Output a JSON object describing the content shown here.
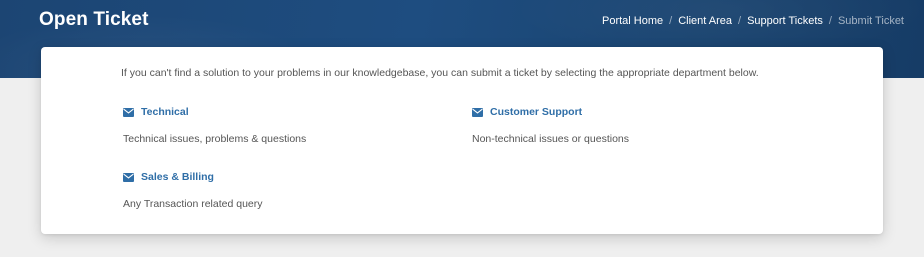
{
  "header": {
    "title": "Open Ticket",
    "breadcrumb": [
      "Portal Home",
      "Client Area",
      "Support Tickets",
      "Submit Ticket"
    ],
    "separator": "/"
  },
  "intro": "If you can't find a solution to your problems in our knowledgebase, you can submit a ticket by selecting the appropriate department below.",
  "departments": [
    {
      "name": "Technical",
      "description": "Technical issues, problems & questions",
      "icon": "envelope-icon"
    },
    {
      "name": "Customer Support",
      "description": "Non-technical issues or questions",
      "icon": "envelope-icon"
    },
    {
      "name": "Sales & Billing",
      "description": "Any Transaction related query",
      "icon": "envelope-icon"
    }
  ],
  "colors": {
    "header_bg": "#1e4d80",
    "link": "#2f6ea7",
    "body_text": "#555555",
    "page_bg": "#efefef"
  }
}
